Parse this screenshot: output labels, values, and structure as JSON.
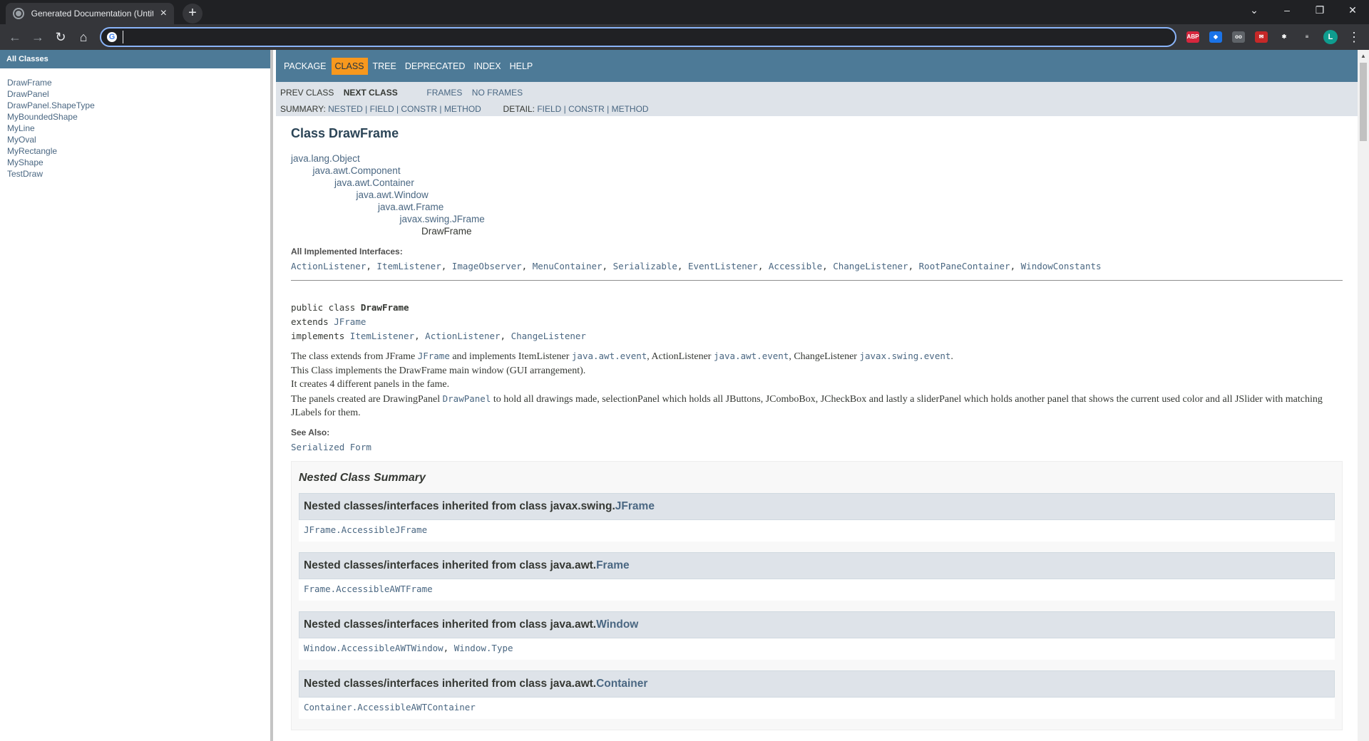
{
  "browser": {
    "tab_title": "Generated Documentation (Untitled)",
    "tab_close": "×",
    "new_tab": "+",
    "address_value": "",
    "window_controls": {
      "tabsearch": "⌄",
      "minimize": "–",
      "restore": "❐",
      "close": "✕"
    },
    "nav": {
      "back": "←",
      "forward": "→",
      "reload": "↻",
      "home": "⌂"
    },
    "extensions": [
      {
        "name": "adblock-plus-icon",
        "label": "ABP",
        "color": "#d7263d"
      },
      {
        "name": "gem-extension-icon",
        "label": "◆",
        "color": "#1a73e8"
      },
      {
        "name": "glasses-extension-icon",
        "label": "oo",
        "color": "#5f6368"
      },
      {
        "name": "mail-extension-icon",
        "label": "✉",
        "color": "#c62828"
      },
      {
        "name": "puzzle-extensions-icon",
        "label": "✱",
        "color": "#35363a"
      },
      {
        "name": "media-queue-icon",
        "label": "≡",
        "color": "#35363a"
      }
    ],
    "profile_initial": "L",
    "profile_color": "#0f9d8f",
    "menu": "⋮"
  },
  "sidebar": {
    "header": "All Classes",
    "classes": [
      "DrawFrame",
      "DrawPanel",
      "DrawPanel.ShapeType",
      "MyBoundedShape",
      "MyLine",
      "MyOval",
      "MyRectangle",
      "MyShape",
      "TestDraw"
    ]
  },
  "topnav": [
    "PACKAGE",
    "CLASS",
    "TREE",
    "DEPRECATED",
    "INDEX",
    "HELP"
  ],
  "topnav_active": "CLASS",
  "subnav": {
    "prev_class": "PREV CLASS",
    "next_class": "NEXT CLASS",
    "frames": "FRAMES",
    "no_frames": "NO FRAMES",
    "summary_label": "SUMMARY:",
    "summary_items": "NESTED | FIELD | CONSTR | METHOD",
    "detail_label": "DETAIL:",
    "detail_items": "FIELD | CONSTR | METHOD"
  },
  "class_title": "Class DrawFrame",
  "inheritance": [
    "java.lang.Object",
    "java.awt.Component",
    "java.awt.Container",
    "java.awt.Window",
    "java.awt.Frame",
    "javax.swing.JFrame",
    "DrawFrame"
  ],
  "interfaces_label": "All Implemented Interfaces:",
  "interfaces": [
    "ActionListener",
    "ItemListener",
    "ImageObserver",
    "MenuContainer",
    "Serializable",
    "EventListener",
    "Accessible",
    "ChangeListener",
    "RootPaneContainer",
    "WindowConstants"
  ],
  "signature": {
    "line1_prefix": "public class ",
    "line1_name": "DrawFrame",
    "line2_prefix": "extends ",
    "line2_link": "JFrame",
    "line3_prefix": "implements ",
    "line3_links": [
      "ItemListener",
      "ActionListener",
      "ChangeListener"
    ]
  },
  "description": {
    "p1_a": "The class extends from JFrame ",
    "p1_code1": "JFrame",
    "p1_b": " and implements ItemListener ",
    "p1_code2": "java.awt.event",
    "p1_c": ", ActionListener ",
    "p1_code3": "java.awt.event",
    "p1_d": ", ChangeListener ",
    "p1_code4": "javax.swing.event",
    "p1_e": ".",
    "p2": "This Class implements the DrawFrame main window (GUI arrangement).",
    "p3": "It creates 4 different panels in the fame.",
    "p4_a": "The panels created are DrawingPanel ",
    "p4_code": "DrawPanel",
    "p4_b": " to hold all drawings made, selectionPanel which holds all JButtons, JComboBox, JCheckBox and lastly a sliderPanel which holds another panel that shows the current used color and all JSlider with matching JLabels for them."
  },
  "see_also_label": "See Also:",
  "see_also_link": "Serialized Form",
  "nested_summary": {
    "title": "Nested Class Summary",
    "prefix": "Nested classes/interfaces inherited from class ",
    "blocks": [
      {
        "pkg": "javax.swing.",
        "cls": "JFrame",
        "items": [
          "JFrame.AccessibleJFrame"
        ]
      },
      {
        "pkg": "java.awt.",
        "cls": "Frame",
        "items": [
          "Frame.AccessibleAWTFrame"
        ]
      },
      {
        "pkg": "java.awt.",
        "cls": "Window",
        "items": [
          "Window.AccessibleAWTWindow",
          "Window.Type"
        ]
      },
      {
        "pkg": "java.awt.",
        "cls": "Container",
        "items": [
          "Container.AccessibleAWTContainer"
        ]
      }
    ]
  }
}
